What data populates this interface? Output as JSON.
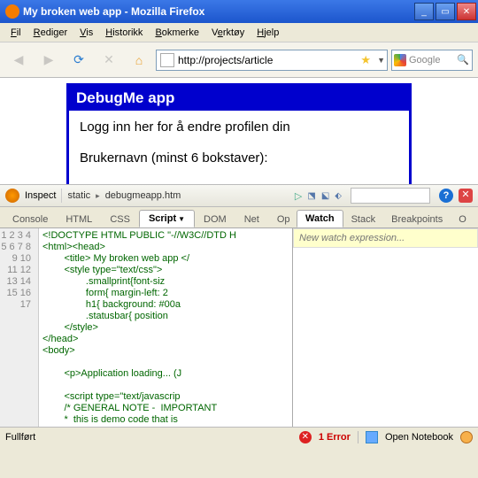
{
  "window": {
    "title": "My broken web app - Mozilla Firefox",
    "min": "_",
    "max": "▭",
    "close": "✕"
  },
  "menu": {
    "file": "Fil",
    "edit": "Rediger",
    "view": "Vis",
    "history": "Historikk",
    "bookmarks": "Bokmerke",
    "tools": "Verktøy",
    "help": "Hjelp"
  },
  "nav": {
    "url": "http://projects/article",
    "search_placeholder": "Google"
  },
  "page": {
    "heading": "DebugMe app",
    "login_text": "Logg inn her for å endre profilen din",
    "username_label": "Brukernavn (minst 6 bokstaver):"
  },
  "firebug": {
    "inspect": "Inspect",
    "crumb1": "static",
    "crumb2": "debugmeapp.htm",
    "tabs": {
      "console": "Console",
      "html": "HTML",
      "css": "CSS",
      "script": "Script",
      "dom": "DOM",
      "net": "Net",
      "options": "Op"
    },
    "side_tabs": {
      "watch": "Watch",
      "stack": "Stack",
      "breakpoints": "Breakpoints",
      "options": "O"
    },
    "watch_placeholder": "New watch expression...",
    "code_lines": [
      "<!DOCTYPE HTML PUBLIC \"-//W3C//DTD H",
      "<html><head>",
      "        <title> My broken web app </",
      "        <style type=\"text/css\">",
      "                .smallprint{font-siz",
      "                form{ margin-left: 2",
      "                h1{ background: #00a",
      "                .statusbar{ position",
      "        </style>",
      "</head>",
      "<body>",
      "",
      "        <p>Application loading... (J",
      "",
      "        <script type=\"text/javascrip",
      "        /* GENERAL NOTE -  IMPORTANT",
      "        *  this is demo code that is"
    ]
  },
  "status": {
    "left": "Fullført",
    "error": "1 Error",
    "notebook": "Open Notebook"
  }
}
